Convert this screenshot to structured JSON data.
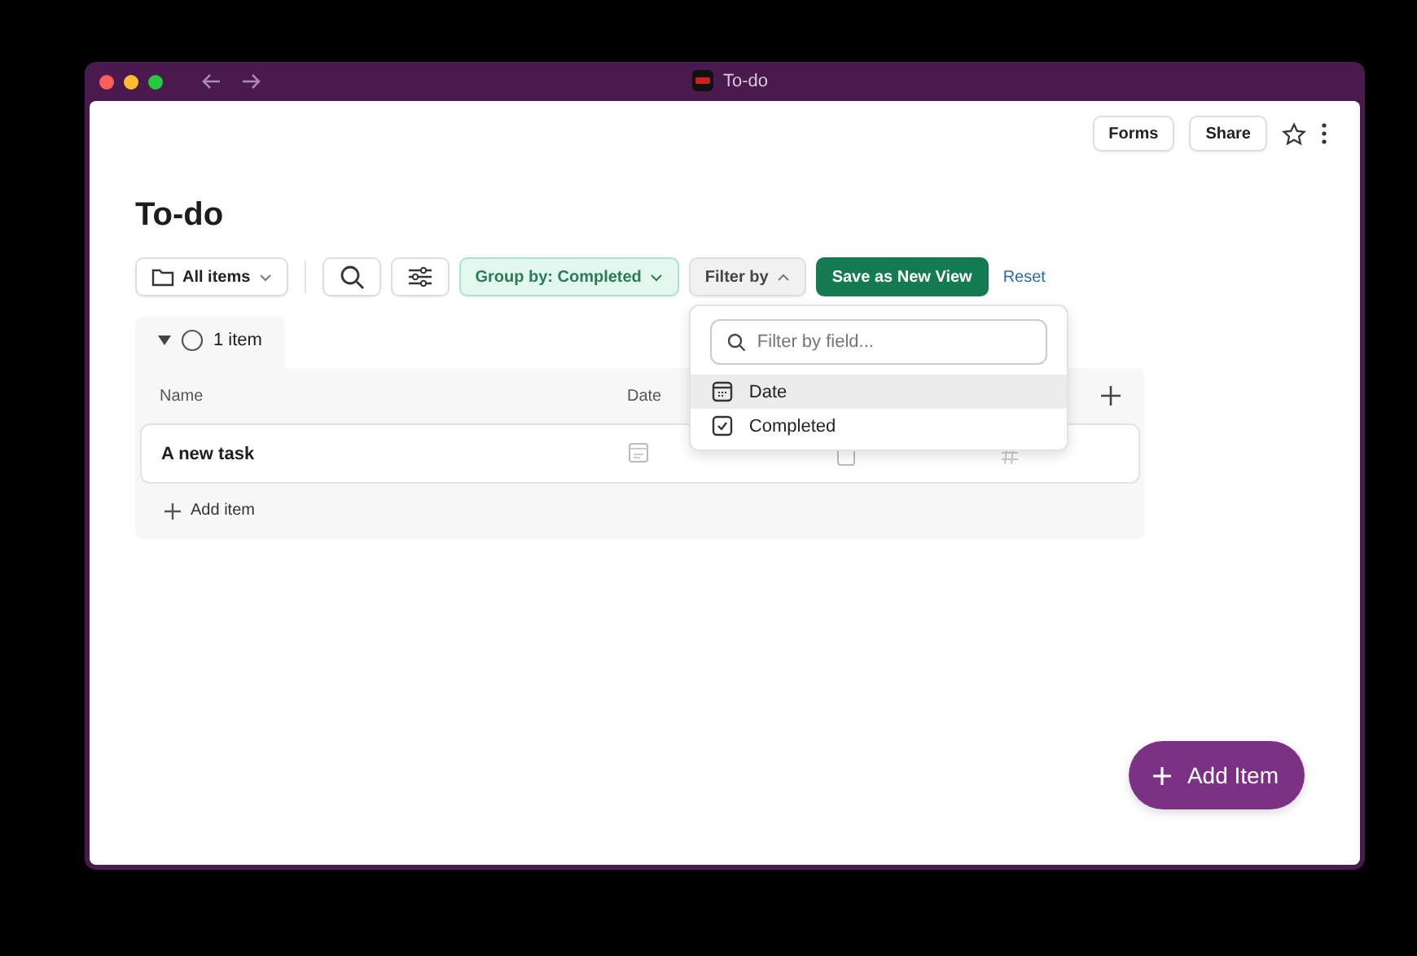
{
  "window": {
    "title": "To-do"
  },
  "header_actions": [
    "Forms",
    "Share"
  ],
  "page_title": "To-do",
  "toolbar": {
    "view": "All items",
    "group_by": "Group by: Completed",
    "filter": "Filter by",
    "save": "Save as New View",
    "reset": "Reset"
  },
  "filter_menu": {
    "placeholder": "Filter by field...",
    "items": [
      {
        "label": "Date",
        "kind": "date",
        "selected": true
      },
      {
        "label": "Completed",
        "kind": "checkbox",
        "selected": false
      }
    ]
  },
  "group": {
    "label": "1 item",
    "expanded": true,
    "columns": [
      "Name",
      "Date"
    ],
    "rows": [
      {
        "name": "A new task",
        "cells": [
          {
            "kind": "date"
          },
          {
            "kind": "checkbox",
            "checked": false
          },
          {
            "kind": "number"
          }
        ]
      }
    ],
    "add_label": "Add item"
  },
  "fab": "Add Item"
}
